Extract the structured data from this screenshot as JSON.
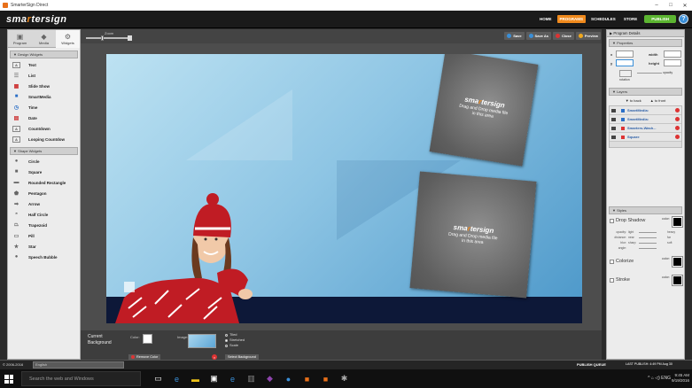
{
  "window": {
    "title": "SmarterSign Direct",
    "controls": [
      "–",
      "□",
      "✕"
    ]
  },
  "brand": {
    "logo_pre": "sma",
    "logo_o": "r",
    "logo_post": "ter",
    "logo_post2": "sign"
  },
  "topnav": {
    "items": [
      "HOME",
      "PROGRAMS",
      "SCHEDULES",
      "STORE"
    ],
    "active": "PROGRAMS",
    "publish": "PUBLISH",
    "help": "?"
  },
  "left_tabs": [
    "Program",
    "Media",
    "Widgets"
  ],
  "design_widgets": {
    "header": "Design Widgets",
    "items": [
      {
        "label": "Text",
        "icon": "A"
      },
      {
        "label": "List",
        "icon": "☰"
      },
      {
        "label": "Slide Show",
        "icon": "▦"
      },
      {
        "label": "SmartMedia",
        "icon": "■"
      },
      {
        "label": "Time",
        "icon": "◷"
      },
      {
        "label": "Date",
        "icon": "▤"
      },
      {
        "label": "Countdown",
        "icon": "A"
      },
      {
        "label": "Looping Countdow",
        "icon": "A"
      }
    ]
  },
  "shape_widgets": {
    "header": "Shape Widgets",
    "items": [
      {
        "label": "Circle",
        "icon": "●"
      },
      {
        "label": "Square",
        "icon": "■"
      },
      {
        "label": "Rounded Rectangle",
        "icon": "▬"
      },
      {
        "label": "Pentagon",
        "icon": "⬟"
      },
      {
        "label": "Arrow",
        "icon": "➡"
      },
      {
        "label": "Half Circle",
        "icon": "◓"
      },
      {
        "label": "Trapezoid",
        "icon": "⏢"
      },
      {
        "label": "Pill",
        "icon": "▭"
      },
      {
        "label": "Star",
        "icon": "★"
      },
      {
        "label": "Speech Bubble",
        "icon": "💬"
      }
    ]
  },
  "editor": {
    "zoom_label": "Zoom",
    "zoom_level": 0.42,
    "toolbar": {
      "save": "Save",
      "save_as": "Save As",
      "close": "Close",
      "preview": "Preview"
    },
    "dropzones": [
      {
        "logo": "smartersign",
        "text": "Drag and Drop media file in this area"
      },
      {
        "logo": "smartersign",
        "text": "Drag and Drop media file in this area"
      }
    ]
  },
  "background_bar": {
    "title": "Current Background",
    "color_label": "Color:",
    "image_label": "Image:",
    "options": [
      "Tiled",
      "Stretched",
      "Scale"
    ],
    "selected_option": "Stretched",
    "remove_color": "Remove Color",
    "select_background": "Select Background"
  },
  "right_panel": {
    "title": "Program Details",
    "properties": {
      "header": "Properties",
      "x": "x",
      "y": "y",
      "width": "width",
      "height": "height",
      "rotation": "rotation",
      "opacity": "opacity"
    },
    "layers": {
      "header": "Layers",
      "to_back": "to back",
      "to_front": "to front",
      "rows": [
        {
          "name": "SmartMedia:",
          "color": "#2b6fc7"
        },
        {
          "name": "SmartMedia:",
          "color": "#2b6fc7"
        },
        {
          "name": "Smarters-Wash...",
          "color": "#d33"
        },
        {
          "name": "Square",
          "color": "#d33"
        }
      ]
    },
    "styles": {
      "header": "Styles",
      "drop_shadow": "Drop Shadow",
      "colorize": "Colorize",
      "stroke": "Stroke",
      "color_label": "color:",
      "sliders": [
        {
          "key": "opacity:",
          "a": "light",
          "b": "heavy"
        },
        {
          "key": "distance:",
          "a": "near",
          "b": "far"
        },
        {
          "key": "blur:",
          "a": "sharp",
          "b": "soft"
        },
        {
          "key": "angle:",
          "a": "",
          "b": ""
        }
      ]
    }
  },
  "statusbar": {
    "copyright": "© 2006-2016",
    "language": "English",
    "publish_queue": "PUBLISH QUEUE",
    "last_publish": "LAST PUBLISH: 4:49 PM Aug 30"
  },
  "taskbar": {
    "search_placeholder": "Search the web and Windows",
    "time": "9:45 AM",
    "date": "9/19/2016",
    "lang": "ENG"
  }
}
